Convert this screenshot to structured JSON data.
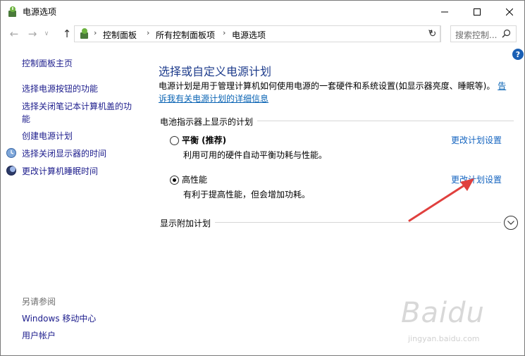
{
  "window": {
    "title": "电源选项"
  },
  "address": {
    "crumbs": [
      "控制面板",
      "所有控制面板项",
      "电源选项"
    ],
    "search_placeholder": "搜索控制..."
  },
  "sidebar": {
    "home": "控制面板主页",
    "links": [
      "选择电源按钮的功能",
      "选择关闭笔记本计算机盖的功能",
      "创建电源计划",
      "选择关闭显示器的时间",
      "更改计算机睡眠时间"
    ],
    "see_also_heading": "另请参阅",
    "see_also": [
      "Windows 移动中心",
      "用户帐户"
    ]
  },
  "main": {
    "title": "选择或自定义电源计划",
    "description": "电源计划是用于管理计算机如何使用电源的一套硬件和系统设置(如显示器亮度、睡眠等)。",
    "description_link": "告诉我有关电源计划的详细信息",
    "group_heading": "电池指示器上显示的计划",
    "plans": [
      {
        "name": "平衡 (推荐)",
        "desc": "利用可用的硬件自动平衡功耗与性能。",
        "link": "更改计划设置",
        "selected": false
      },
      {
        "name": "高性能",
        "desc": "有利于提高性能，但会增加功耗。",
        "link": "更改计划设置",
        "selected": true
      }
    ],
    "extra_plans": "显示附加计划"
  },
  "watermark": {
    "brand": "Baidu",
    "sub": "jingyan.baidu.com"
  },
  "colors": {
    "link": "#1565c0",
    "title": "#1e3c8c",
    "arrow": "#e0403e"
  }
}
